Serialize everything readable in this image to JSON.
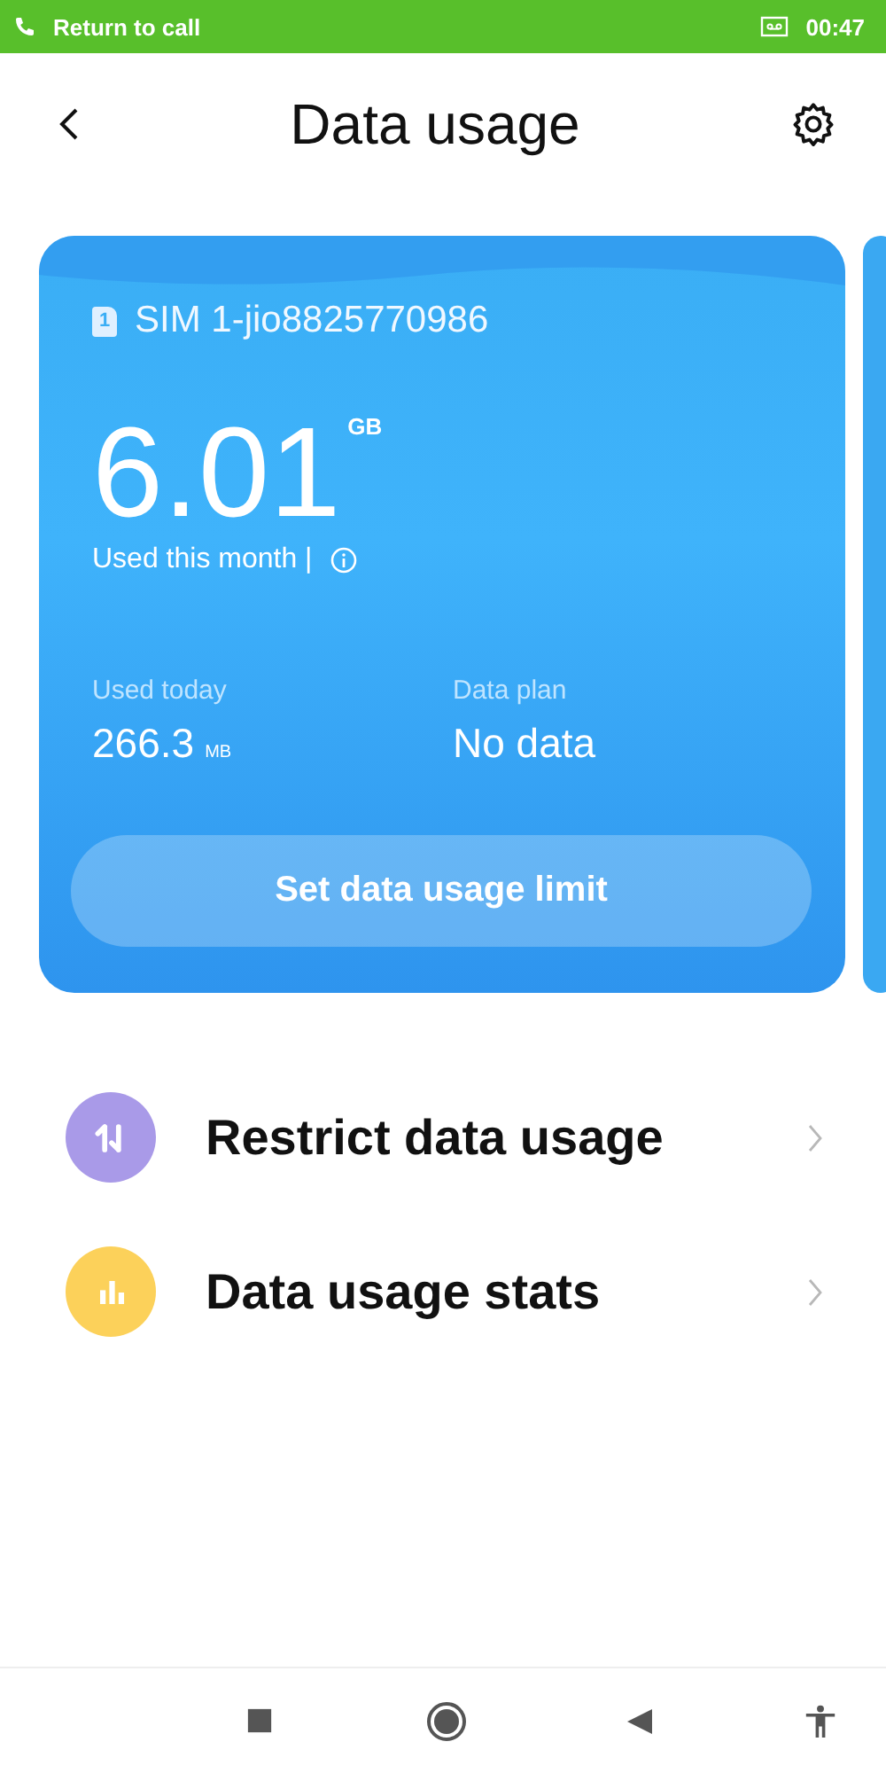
{
  "status_bar": {
    "call_text": "Return to call",
    "time": "00:47"
  },
  "header": {
    "title": "Data usage"
  },
  "card": {
    "sim": "SIM 1-jio8825770986",
    "sim_slot": "1",
    "used_value": "6.01",
    "used_unit": "GB",
    "used_label": "Used this month |",
    "today_label": "Used today",
    "today_value": "266.3",
    "today_unit": "MB",
    "plan_label": "Data plan",
    "plan_value": "No data",
    "button": "Set data usage limit"
  },
  "menu": [
    {
      "label": "Restrict data usage",
      "kind": "restrict",
      "color": "#a99ae8"
    },
    {
      "label": "Data usage stats",
      "kind": "stats",
      "color": "#fcd15a"
    }
  ]
}
